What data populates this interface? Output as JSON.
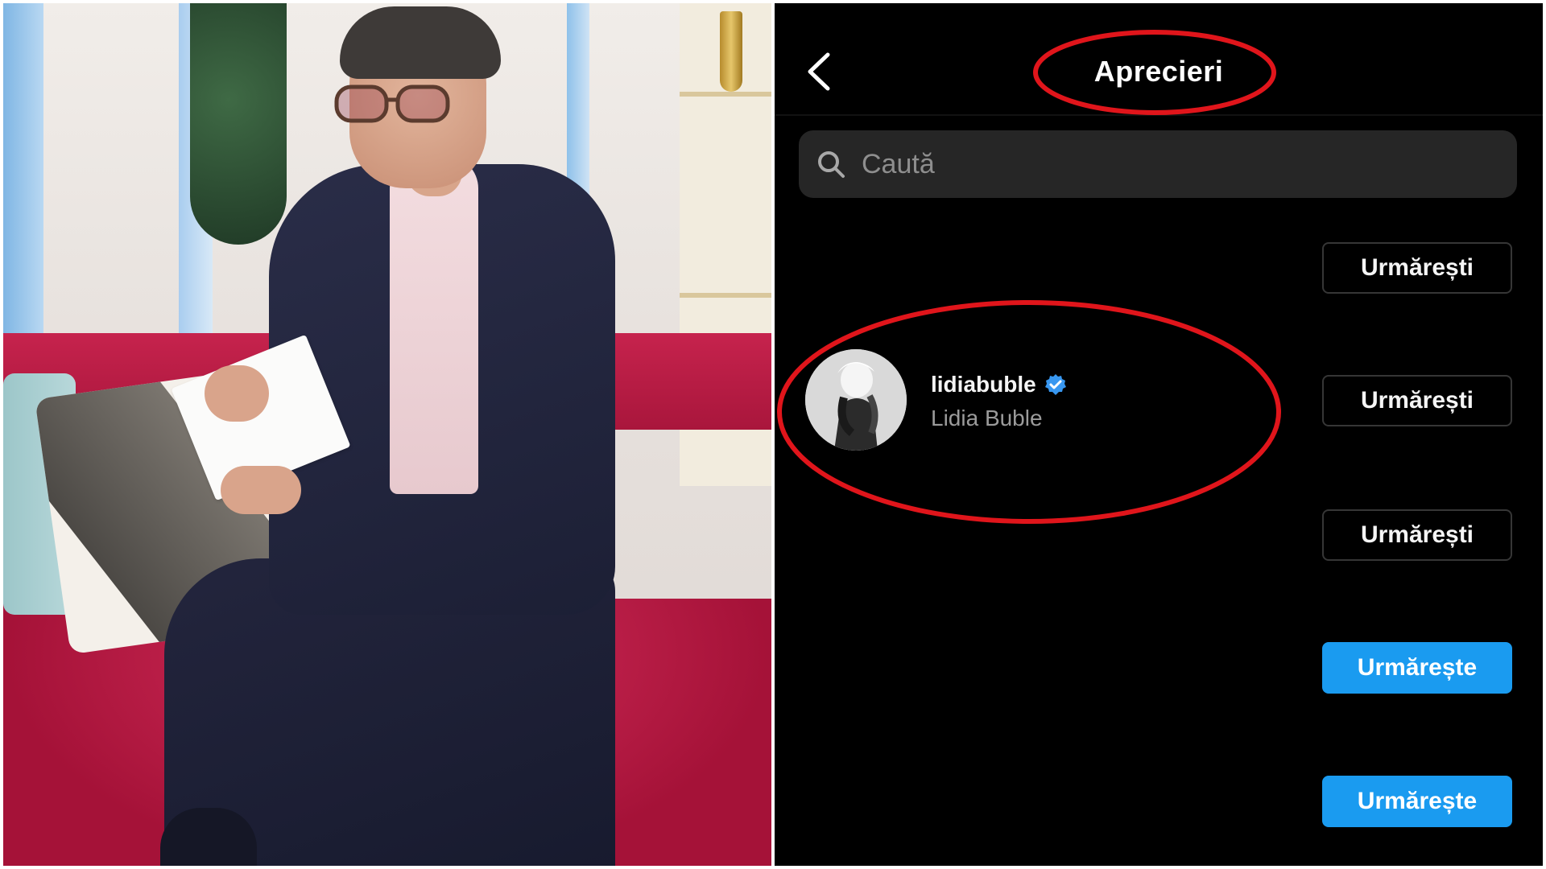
{
  "photo": {
    "description_icon": "photo-of-man-on-sofa"
  },
  "header": {
    "back_icon": "chevron-left-icon",
    "title": "Aprecieri"
  },
  "search": {
    "placeholder": "Caută",
    "icon": "search-icon"
  },
  "rows": [
    {
      "button_label": "Urmărești",
      "button_style": "outline"
    },
    {
      "username": "lidiabuble",
      "fullname": "Lidia Buble",
      "verified": true,
      "button_label": "Urmărești",
      "button_style": "outline"
    },
    {
      "button_label": "Urmărești",
      "button_style": "outline"
    },
    {
      "button_label": "Urmărește",
      "button_style": "primary"
    },
    {
      "button_label": "Urmărește",
      "button_style": "primary"
    }
  ],
  "colors": {
    "background": "#000000",
    "search_bg": "#262626",
    "primary_button": "#1a9bf0",
    "annotation_red": "#e0151b",
    "verified_blue": "#3897f0"
  }
}
